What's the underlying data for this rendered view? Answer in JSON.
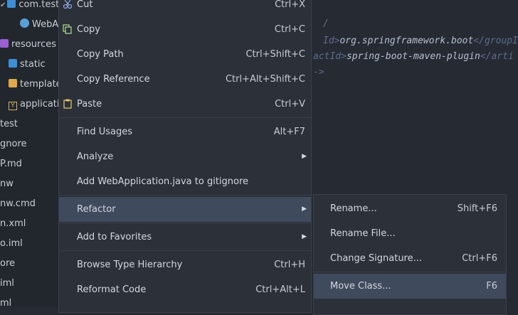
{
  "tree": {
    "items": [
      {
        "label": "com.test",
        "icon": "package-icon"
      },
      {
        "label": "WebA",
        "icon": "class-icon"
      },
      {
        "label": "resources",
        "icon": "resources-folder-icon"
      },
      {
        "label": "static",
        "icon": "folder-icon"
      },
      {
        "label": "template",
        "icon": "folder-icon"
      },
      {
        "label": "applicati",
        "icon": "yaml-icon"
      },
      {
        "label": "test"
      },
      {
        "label": "gnore"
      },
      {
        "label": "P.md"
      },
      {
        "label": "nw"
      },
      {
        "label": "nw.cmd"
      },
      {
        "label": "n.xml"
      },
      {
        "label": "o.iml"
      },
      {
        "label": "ore"
      },
      {
        "label": "iml"
      },
      {
        "label": "ml"
      }
    ]
  },
  "editor": {
    "line1_prefix": "Id>",
    "line1_value": "org.springframework.boot",
    "line1_suffix": "</groupId",
    "line2_prefix": "actId>",
    "line2_value": "spring-boot-maven-plugin",
    "line2_suffix": "</arti",
    "line3": "->",
    "line0": "/"
  },
  "menu": {
    "cut": {
      "label": "Cut",
      "shortcut": "Ctrl+X"
    },
    "copy": {
      "label": "Copy",
      "shortcut": "Ctrl+C"
    },
    "copy_path": {
      "label": "Copy Path",
      "shortcut": "Ctrl+Shift+C"
    },
    "copy_reference": {
      "label": "Copy Reference",
      "shortcut": "Ctrl+Alt+Shift+C"
    },
    "paste": {
      "label": "Paste",
      "shortcut": "Ctrl+V"
    },
    "find_usages": {
      "label": "Find Usages",
      "shortcut": "Alt+F7"
    },
    "analyze": {
      "label": "Analyze"
    },
    "add_gitignore": {
      "label": "Add WebApplication.java to gitignore"
    },
    "refactor": {
      "label": "Refactor"
    },
    "add_favorites": {
      "label": "Add to Favorites"
    },
    "browse_hierarchy": {
      "label": "Browse Type Hierarchy",
      "shortcut": "Ctrl+H"
    },
    "reformat": {
      "label": "Reformat Code",
      "shortcut": "Ctrl+Alt+L"
    }
  },
  "submenu": {
    "rename": {
      "label": "Rename...",
      "shortcut": "Shift+F6"
    },
    "rename_file": {
      "label": "Rename File..."
    },
    "change_signature": {
      "label": "Change Signature...",
      "shortcut": "Ctrl+F6"
    },
    "move_class": {
      "label": "Move Class...",
      "shortcut": "F6"
    }
  },
  "colors": {
    "menu_bg": "#2b3039",
    "selected_bg": "#3f4a5c",
    "editor_bg": "#262b33"
  }
}
